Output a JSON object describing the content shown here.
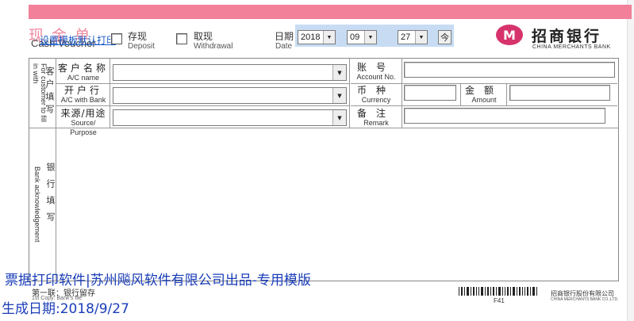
{
  "header": {
    "title_cn": "现 金 单",
    "title_en": "Cash Voucher",
    "template_link": "设置模板默认打印",
    "deposit_cn": "存现",
    "deposit_en": "Deposit",
    "withdrawal_cn": "取现",
    "withdrawal_en": "Withdrawal",
    "date_cn": "日期",
    "date_en": "Date",
    "year": "2018",
    "month": "09",
    "day": "27",
    "today_button": "今"
  },
  "logo": {
    "mark": "M",
    "name_cn": "招商银行",
    "name_en": "CHINA MERCHANTS BANK"
  },
  "colors": {
    "brand_pink": "#f2809a",
    "logo_red": "#d6336c",
    "date_bar": "#c7dcf3",
    "overlay_blue": "#1a3db8"
  },
  "customer_section": {
    "side_label": "客户填写",
    "side_label_en": "For customer to fill in with",
    "account_name_cn": "客户名称",
    "account_name_en": "A/C  name",
    "account_name_value": "",
    "bank_cn": "开户行",
    "bank_en": "A/C with Bank",
    "bank_value": "",
    "source_cn": "来源/用途",
    "source_en": "Source/ Purpose",
    "source_value": "",
    "account_no_cn": "账号",
    "account_no_en": "Account No.",
    "account_no_value": "",
    "currency_cn": "币种",
    "currency_en": "Currency",
    "currency_value": "",
    "amount_cn": "金额",
    "amount_en": "Amount",
    "amount_value": "",
    "remark_cn": "备注",
    "remark_en": "Remark",
    "remark_value": ""
  },
  "bank_section": {
    "side_label": "银行填写",
    "side_label_en": "Bank acknowledgement"
  },
  "footer": {
    "copy_label_cn": "第一联：银行留存",
    "copy_label_en": "1st Copy: Bank's file",
    "form_code": "F41",
    "printer_cn": "招商银行股份有限公司",
    "printer_en": "CHINA MERCHANTS BANK CO.,LTD."
  },
  "overlay": {
    "software_line": "票据打印软件|苏州飚风软件有限公司出品-专用模版",
    "generated_line": "生成日期:2018/9/27"
  }
}
